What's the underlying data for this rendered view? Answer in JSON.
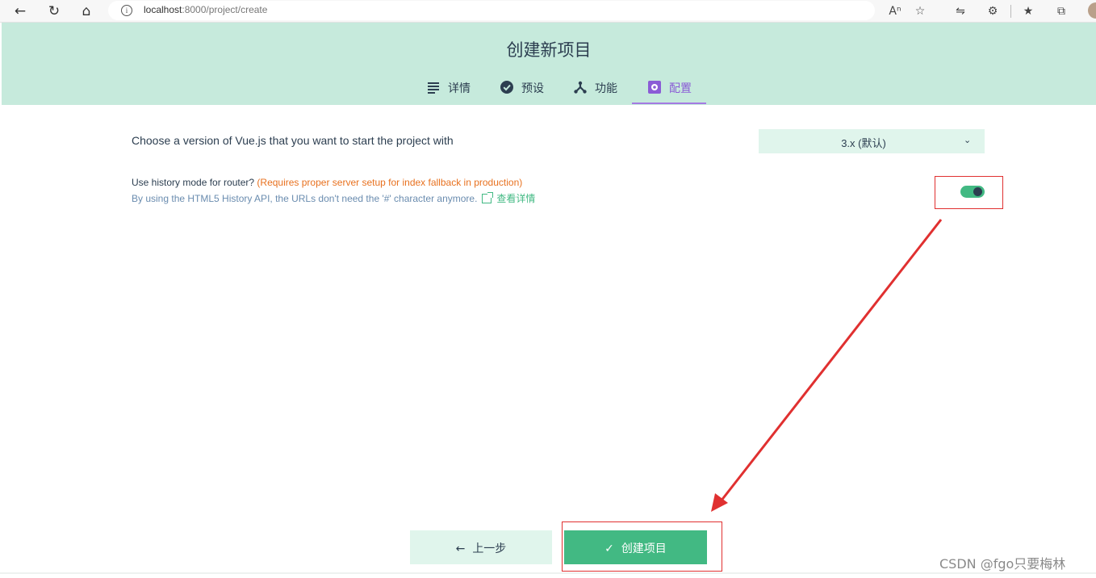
{
  "browser": {
    "url_prefix": "localhost",
    "url_rest": ":8000/project/create",
    "info_icon": "i"
  },
  "header": {
    "title": "创建新项目",
    "tabs": [
      {
        "label": "详情",
        "icon": "list-icon"
      },
      {
        "label": "预设",
        "icon": "check-circle-icon"
      },
      {
        "label": "功能",
        "icon": "fork-icon"
      },
      {
        "label": "配置",
        "icon": "settings-icon",
        "active": true
      }
    ]
  },
  "config": {
    "version_prompt": "Choose a version of Vue.js that you want to start the project with",
    "version_value": "3.x (默认)",
    "history_question": "Use history mode for router?",
    "history_warning": "(Requires proper server setup for index fallback in production)",
    "history_description": "By using the HTML5 History API, the URLs don't need the '#' character anymore.",
    "more_link": "查看详情",
    "history_enabled": true
  },
  "footer": {
    "prev_label": "上一步",
    "create_label": "创建项目"
  },
  "watermark": "CSDN @fgo只要梅林",
  "colors": {
    "accent": "#42b983",
    "header_bg": "#c6eadc",
    "active_tab": "#8b5cd6",
    "annotation": "#e03030"
  }
}
